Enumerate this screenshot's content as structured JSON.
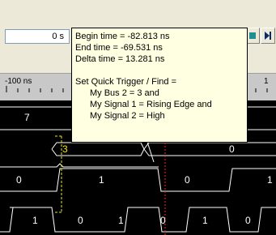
{
  "toolbar": {
    "time_value": "0 s",
    "buttons": [
      {
        "name": "find-previous-icon",
        "color": "#1f8f3a"
      },
      {
        "name": "marker-yellow-icon",
        "color": "#f4d40a"
      },
      {
        "name": "marker-orange-icon",
        "color": "#ff8c00"
      },
      {
        "name": "stop-icon",
        "color": "#d01010"
      },
      {
        "name": "find-next-icon",
        "color": "#1f8f8f"
      },
      {
        "name": "play-to-end-icon",
        "color": "#0a2a6a"
      }
    ]
  },
  "ruler": {
    "left_label": "-100 ns",
    "right_label": "1"
  },
  "tooltip": {
    "begin_time": "Begin time = -82.813 ns",
    "end_time": "End time = -69.531 ns",
    "delta_time": "Delta time = 13.281 ns",
    "heading": "Set Quick Trigger / Find =",
    "conditions": [
      "My Bus 2 = 3 and",
      "My Signal 1 = Rising Edge and",
      "My Signal 2 = High"
    ]
  },
  "waveforms": {
    "bus1_value": "7",
    "bus2_values": [
      "3",
      "0"
    ],
    "signal1_values": [
      "0",
      "1",
      "0",
      "1"
    ],
    "signal2_values": [
      "1",
      "0",
      "1",
      "0",
      "1",
      "0"
    ]
  },
  "colors": {
    "waveform": "#ffffff",
    "selection": "#f2e600",
    "cursor": "#ff2020",
    "background": "#000000",
    "tooltip_bg": "#ffffe1"
  }
}
